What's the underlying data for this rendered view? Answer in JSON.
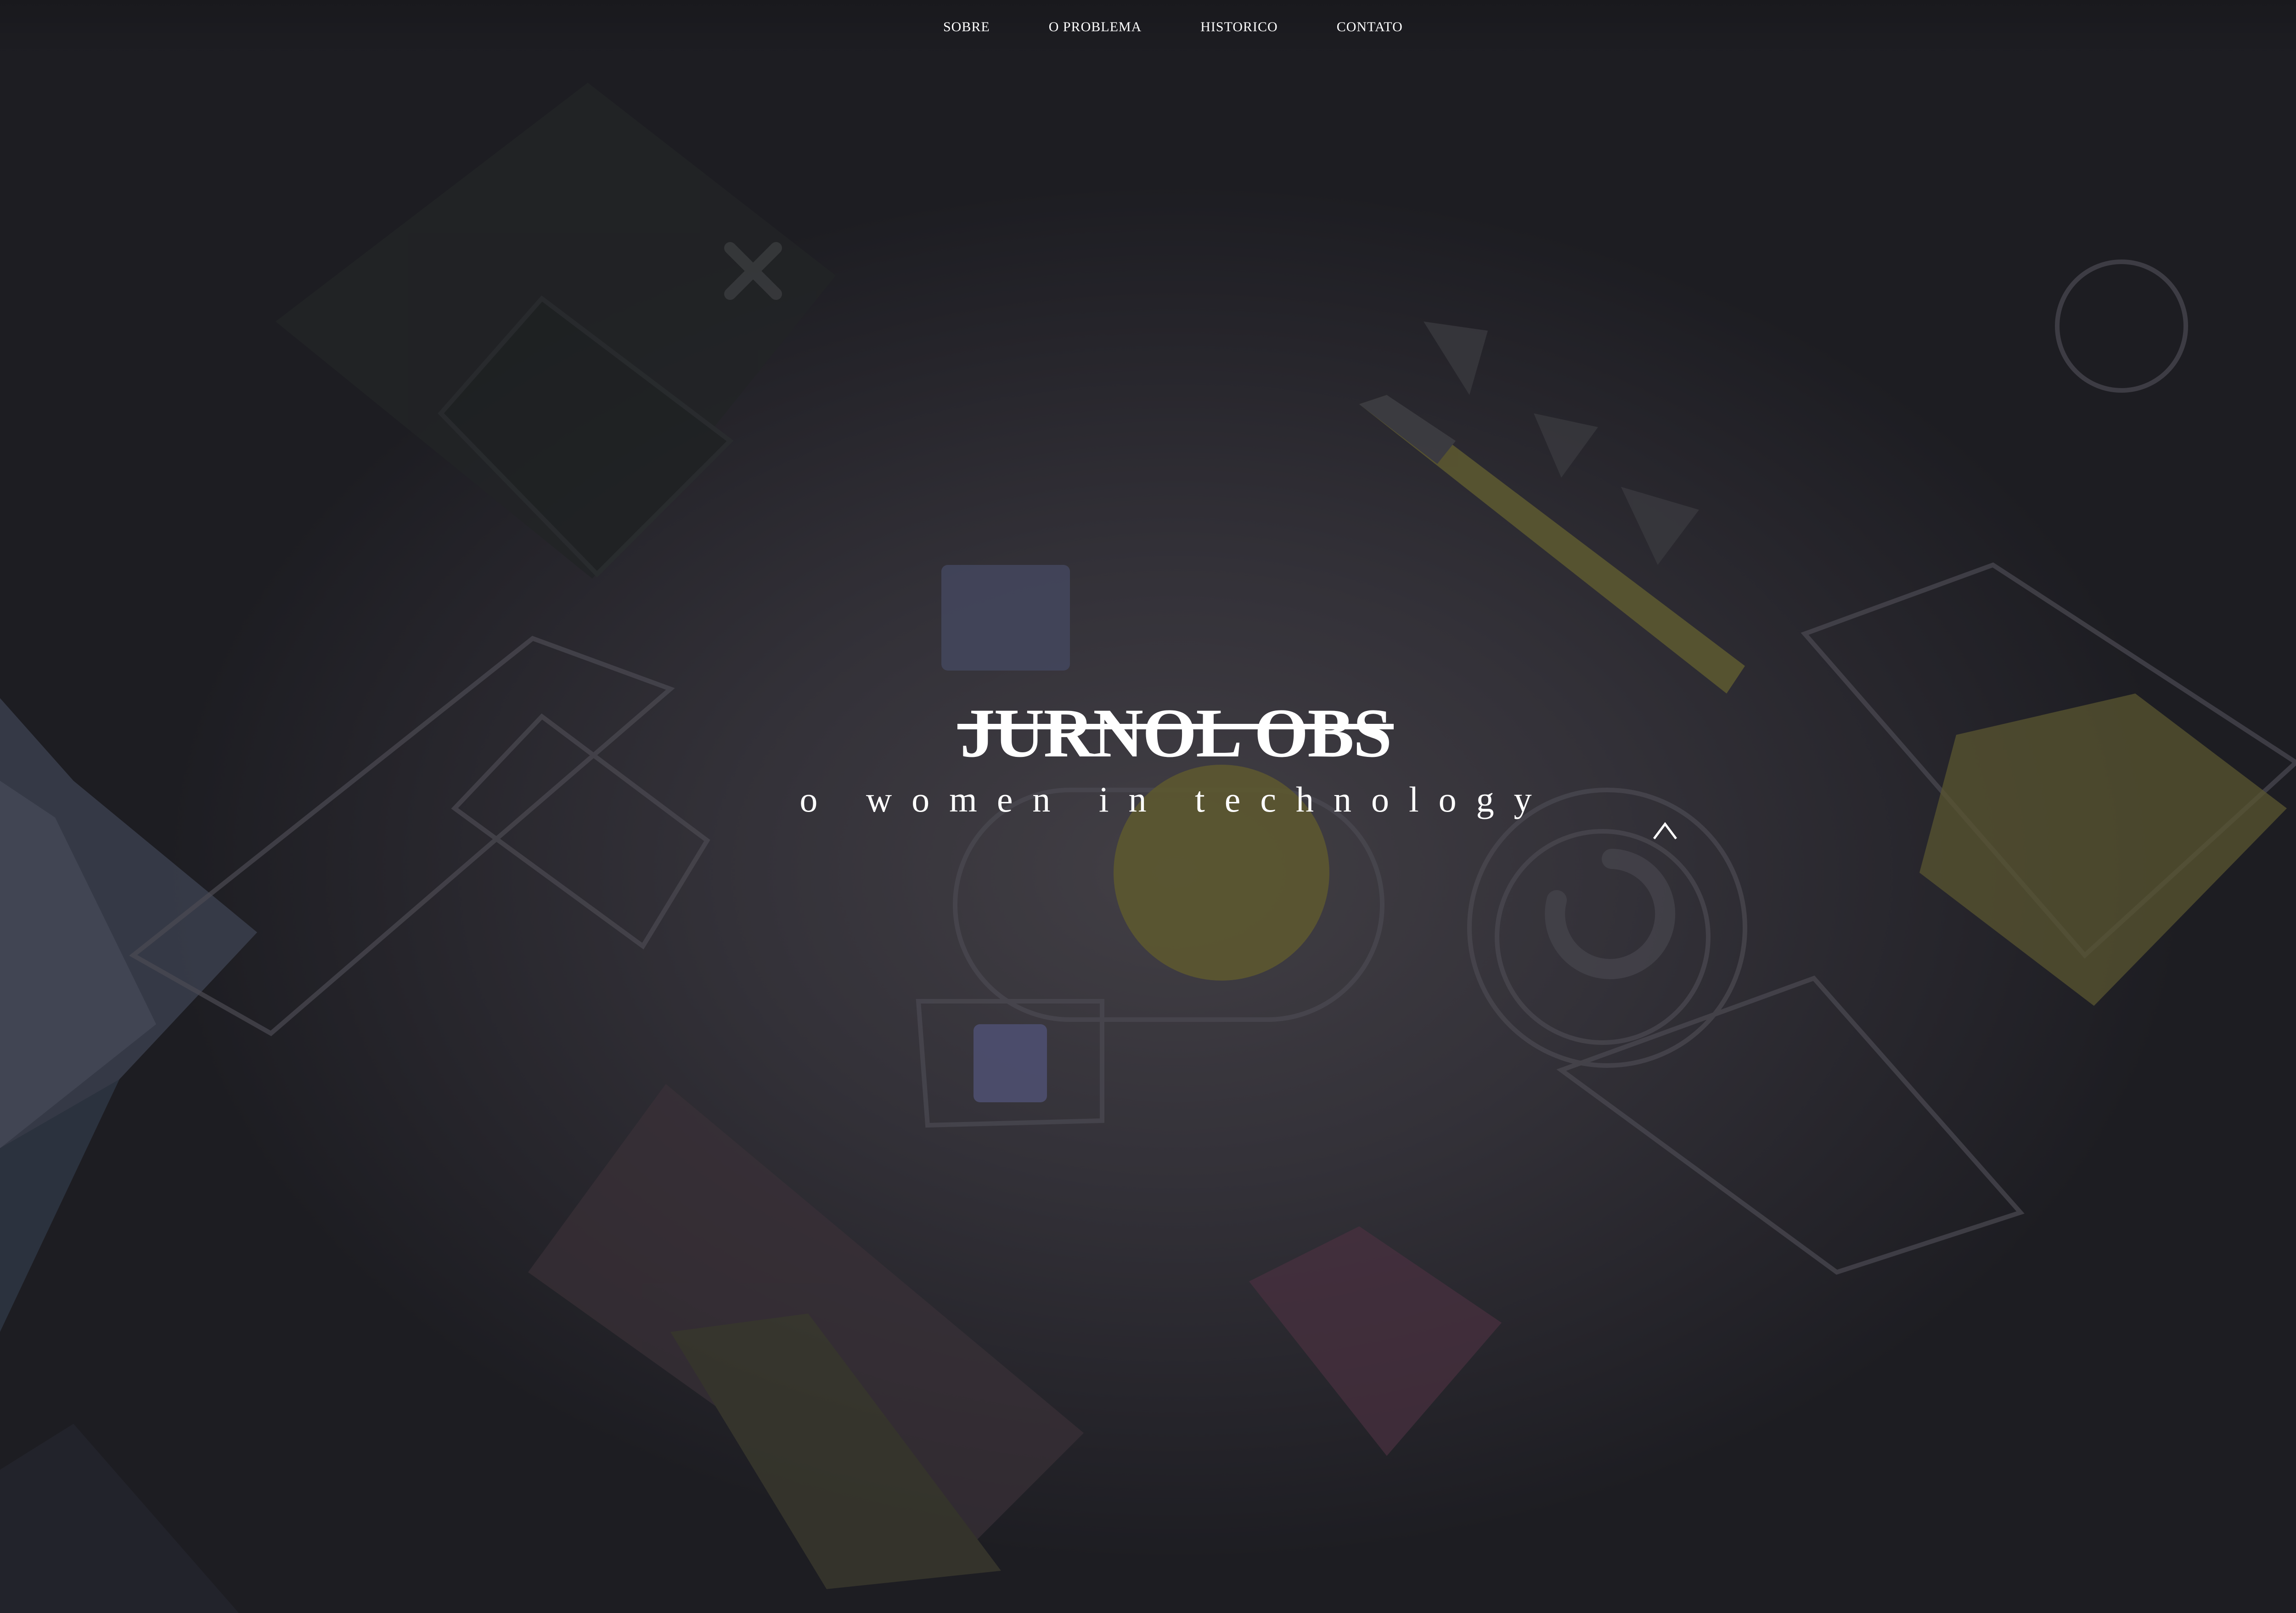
{
  "nav": {
    "items": [
      {
        "label": "SOBRE"
      },
      {
        "label": "O PROBLEMA"
      },
      {
        "label": "HISTORICO"
      },
      {
        "label": "CONTATO"
      }
    ]
  },
  "hero": {
    "title": "JURNOL OBS",
    "subtitle": "o women in technology"
  },
  "icons": {
    "scroll_up": "caret-up-icon"
  },
  "colors": {
    "background": "#2a292e",
    "text": "#ffffff",
    "accent_yellow": "#5c5830",
    "accent_pink": "#4a3040",
    "accent_blue": "#43465c"
  }
}
